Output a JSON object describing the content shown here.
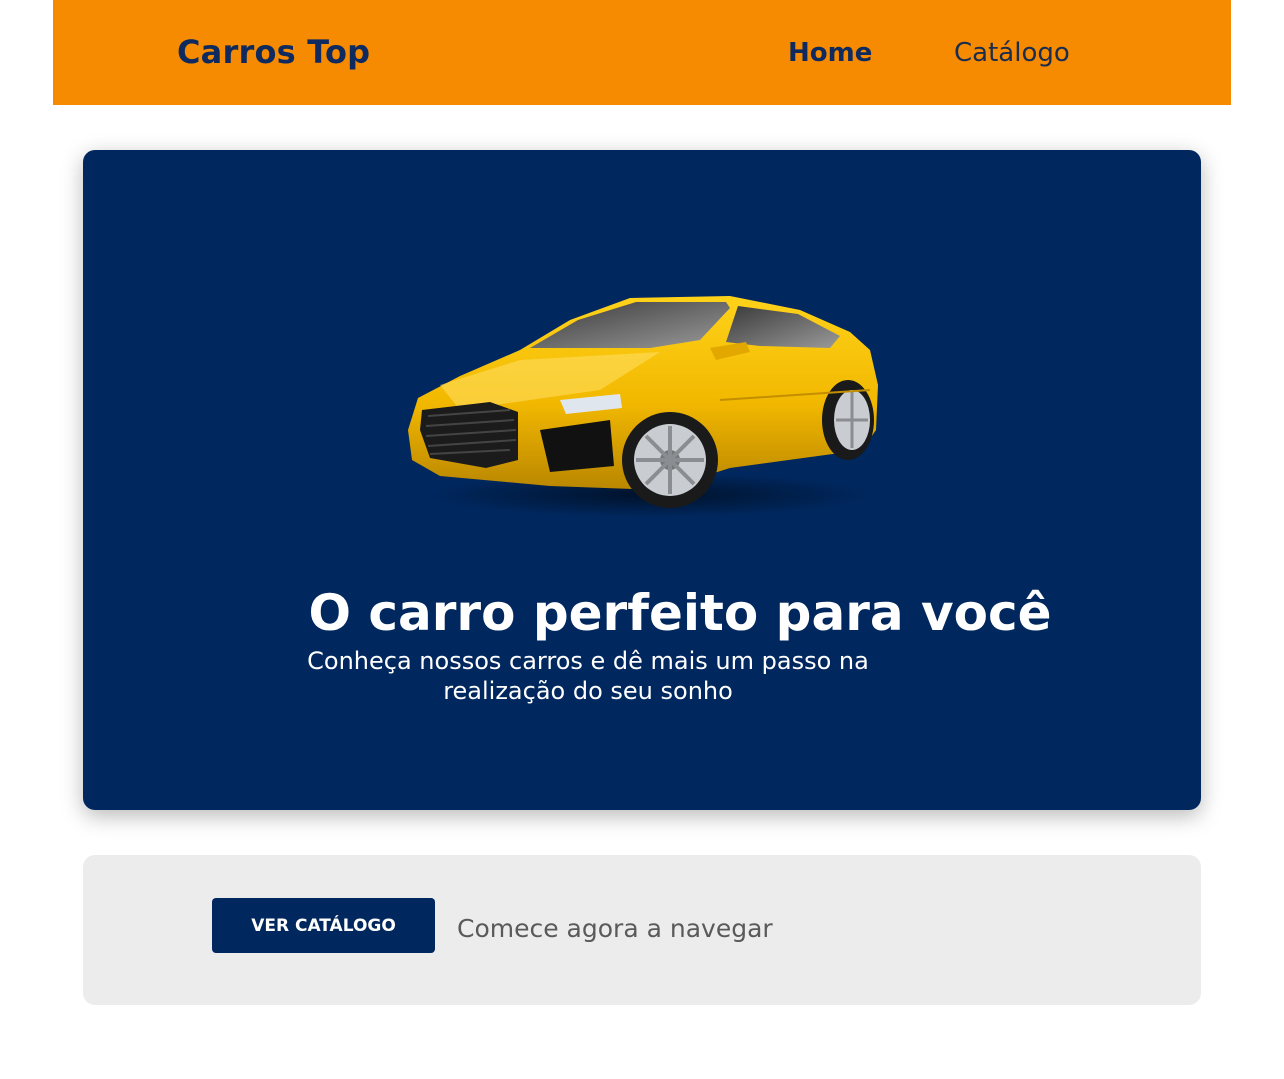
{
  "navbar": {
    "brand": "Carros Top",
    "links": [
      {
        "label": "Home",
        "active": true
      },
      {
        "label": "Catálogo",
        "active": false
      }
    ],
    "background": "#f68a00",
    "text_color": "#0e2a5e"
  },
  "hero": {
    "title": "O carro perfeito para você",
    "subtitle": "Conheça nossos carros e dê mais um passo na realização do seu sonho",
    "background": "#00275e",
    "image": "yellow-sports-car"
  },
  "cta": {
    "button_label": "VER CATÁLOGO",
    "text": "Comece agora a navegar",
    "background": "#ececec"
  }
}
